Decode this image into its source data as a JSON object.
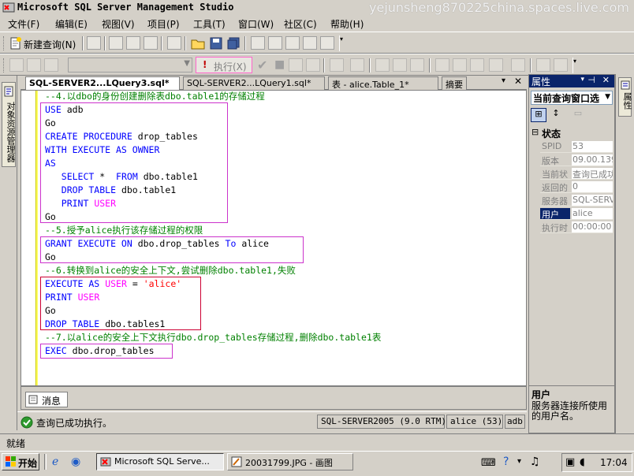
{
  "window": {
    "title": "Microsoft SQL Server Management Studio",
    "watermark": "yejunsheng870225china.spaces.live.com"
  },
  "menu": [
    "文件(F)",
    "编辑(E)",
    "视图(V)",
    "项目(P)",
    "工具(T)",
    "窗口(W)",
    "社区(C)",
    "帮助(H)"
  ],
  "toolbar": {
    "new_query_label": "新建查询(N)",
    "execute_label": "执行(X)"
  },
  "left_strip": {
    "object_explorer_label": "对象资源管理器"
  },
  "right_strip": {
    "label": "属性"
  },
  "tabs": [
    {
      "label": "SQL-SERVER2...LQuery3.sql*",
      "active": true
    },
    {
      "label": "SQL-SERVER2...LQuery1.sql*",
      "active": false
    },
    {
      "label": "表 - alice.Table_1*",
      "active": false
    },
    {
      "label": "摘要",
      "active": false
    }
  ],
  "editor": {
    "lines": [
      {
        "t": "comment",
        "text": "--4.以dbo的身份创建删除表dbo.table1的存储过程"
      },
      {
        "t": "code",
        "parts": [
          [
            "kw",
            "USE"
          ],
          [
            "",
            "adb"
          ]
        ]
      },
      {
        "t": "code",
        "parts": [
          [
            "",
            "Go"
          ]
        ]
      },
      {
        "t": "code",
        "parts": [
          [
            "kw",
            "CREATE PROCEDURE"
          ],
          [
            "",
            "drop_tables"
          ]
        ]
      },
      {
        "t": "code",
        "parts": [
          [
            "kw",
            "WITH EXECUTE AS OWNER"
          ]
        ]
      },
      {
        "t": "code",
        "parts": [
          [
            "kw",
            "AS"
          ]
        ]
      },
      {
        "t": "code",
        "parts": [
          [
            "kw",
            "   SELECT"
          ],
          [
            "",
            "* "
          ],
          [
            "kw",
            "FROM"
          ],
          [
            "",
            "dbo.table1"
          ]
        ]
      },
      {
        "t": "code",
        "parts": [
          [
            "kw",
            "   DROP TABLE"
          ],
          [
            "",
            "dbo.table1"
          ]
        ]
      },
      {
        "t": "code",
        "parts": [
          [
            "kw",
            "   PRINT"
          ],
          [
            "fn",
            "USER"
          ]
        ]
      },
      {
        "t": "code",
        "parts": [
          [
            "",
            "Go"
          ]
        ]
      },
      {
        "t": "comment",
        "text": "--5.授予alice执行该存储过程的权限"
      },
      {
        "t": "code",
        "parts": [
          [
            "kw",
            "GRANT EXECUTE ON"
          ],
          [
            "",
            "dbo.drop_tables"
          ],
          [
            "kw",
            "To"
          ],
          [
            "",
            "alice"
          ]
        ]
      },
      {
        "t": "code",
        "parts": [
          [
            "",
            "Go"
          ]
        ]
      },
      {
        "t": "comment",
        "text": "--6.转换到alice的安全上下文,尝试删除dbo.table1,失败"
      },
      {
        "t": "code",
        "parts": [
          [
            "kw",
            "EXECUTE AS"
          ],
          [
            "fn",
            "USER"
          ],
          [
            "",
            "="
          ],
          [
            "str",
            "'alice'"
          ]
        ]
      },
      {
        "t": "code",
        "parts": [
          [
            "kw",
            "PRINT"
          ],
          [
            "fn",
            "USER"
          ]
        ]
      },
      {
        "t": "code",
        "parts": [
          [
            "",
            "Go"
          ]
        ]
      },
      {
        "t": "code",
        "parts": [
          [
            "kw",
            "DROP TABLE"
          ],
          [
            "",
            "dbo.tables1"
          ]
        ]
      },
      {
        "t": "comment",
        "text": "--7.以alice的安全上下文执行dbo.drop_tables存储过程,删除dbo.table1表"
      },
      {
        "t": "code",
        "parts": [
          [
            "kw",
            "EXEC"
          ],
          [
            "",
            "dbo.drop_tables"
          ]
        ]
      }
    ]
  },
  "results": {
    "messages_tab": "消息"
  },
  "status": {
    "message": "查询已成功执行。",
    "server": "SQL-SERVER2005 (9.0 RTM)",
    "user": "alice (53)",
    "db": "adb"
  },
  "properties": {
    "title": "属性",
    "selector": "当前查询窗口选",
    "category": "状态",
    "rows": [
      {
        "key": "SPID",
        "value": "53"
      },
      {
        "key": "版本",
        "value": "09.00.139"
      },
      {
        "key": "当前状",
        "value": "查询已成功"
      },
      {
        "key": "返回的",
        "value": "0"
      },
      {
        "key": "服务器",
        "value": "SQL-SERVE"
      },
      {
        "key": "用户",
        "value": "alice",
        "selected": true
      },
      {
        "key": "执行时",
        "value": "00:00:00"
      }
    ],
    "desc_title": "用户",
    "desc_text": "服务器连接所使用的用户名。"
  },
  "app_status": "就绪",
  "taskbar": {
    "start": "开始",
    "items": [
      {
        "label": "Microsoft SQL Serve...",
        "active": true
      },
      {
        "label": "20031799.JPG - 画图",
        "active": false
      }
    ],
    "clock": "17:04"
  }
}
